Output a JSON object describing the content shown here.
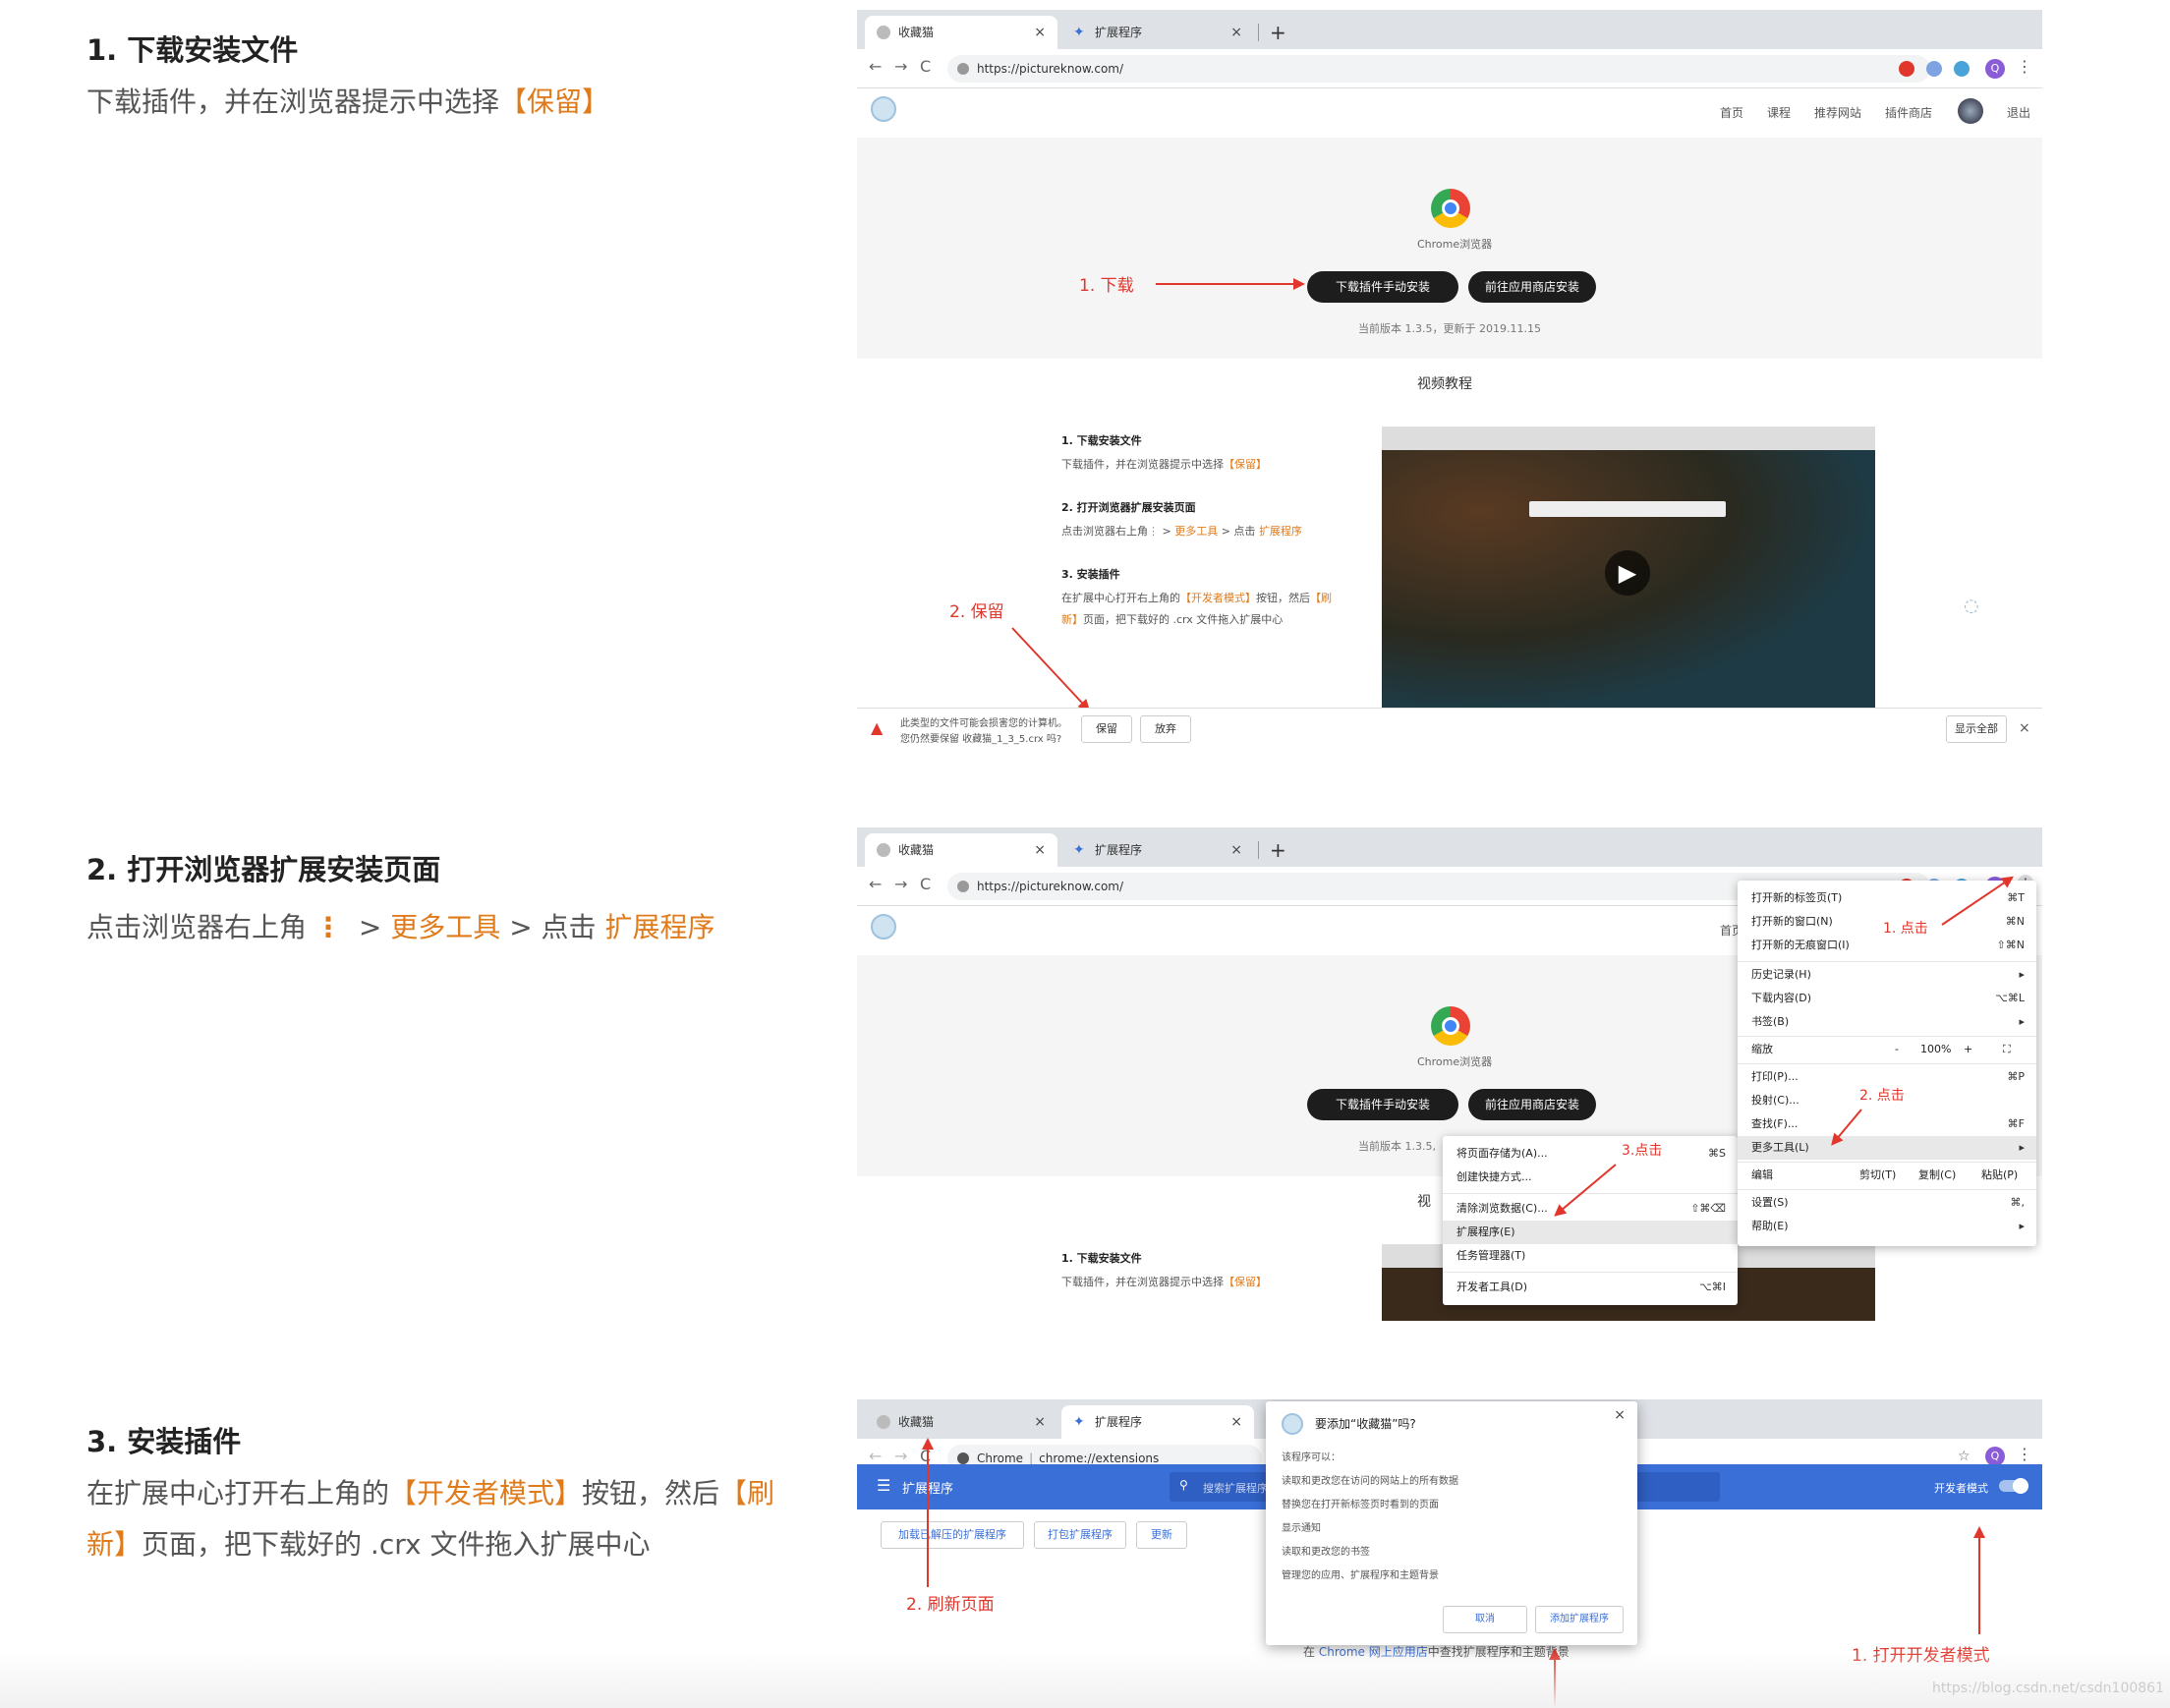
{
  "steps": [
    {
      "title": "1. 下载安装文件",
      "desc_pre": "下载插件，并在浏览器提示中选择",
      "desc_hl": "【保留】"
    },
    {
      "title": "2. 打开浏览器扩展安装页面",
      "desc_pre": "点击浏览器右上角",
      "dots": "⋮",
      "gt1": " > ",
      "hl1": "更多工具",
      "gt2": " > 点击 ",
      "hl2": "扩展程序"
    },
    {
      "title": "3. 安装插件",
      "l1_pre": "在扩展中心打开右上角的",
      "l1_hl": "【开发者模式】",
      "l1_mid": "按钮，然后",
      "l1_hl2": "【刷",
      "l2_hl": "新】",
      "l2_post": "页面，把下载好的 .crx 文件拖入扩展中心"
    }
  ],
  "browser": {
    "tab1": "收藏猫",
    "tab2": "扩展程序",
    "close": "×",
    "plus": "+",
    "back": "←",
    "forward": "→",
    "reload": "C",
    "url": "https://pictureknow.com/",
    "url_ext_chip": "Chrome",
    "url_ext": "chrome://extensions",
    "more": "⋮",
    "avatar": "Q",
    "star": "☆"
  },
  "site": {
    "nav": [
      "首页",
      "课程",
      "推荐网站",
      "插件商店",
      "退出"
    ],
    "chrome_caption": "Chrome浏览器",
    "btn_manual": "下载插件手动安装",
    "btn_store": "前往应用商店安装",
    "version": "当前版本 1.3.5，更新于 2019.11.15",
    "version_short": "当前版本 1.3.5,",
    "video_title": "视频教程",
    "video_title_short": "视",
    "mini": {
      "s1t": "1. 下载安装文件",
      "s1d_pre": "下载插件，并在浏览器提示中选择",
      "s1d_hl": "【保留】",
      "s2t": "2. 打开浏览器扩展安装页面",
      "s2d_pre": "点击浏览器右上角",
      "s2d_dots": "⋮",
      "s2d_gt1": " > ",
      "s2d_hl1": "更多工具",
      "s2d_gt2": " > 点击 ",
      "s2d_hl2": "扩展程序",
      "s3t": "3. 安装插件",
      "s3d1_pre": "在扩展中心打开右上角的",
      "s3d1_hl": "【开发者模式】",
      "s3d1_mid": "按钮，然后",
      "s3d1_hl2": "【刷",
      "s3d2_hl": "新】",
      "s3d2_post": "页面，把下载好的 .crx 文件拖入扩展中心"
    }
  },
  "download_bar": {
    "warn1": "此类型的文件可能会损害您的计算机。",
    "warn2": "您仍然要保留 收藏猫_1_3_5.crx 吗?",
    "keep": "保留",
    "discard": "放弃",
    "show_all": "显示全部",
    "close": "×"
  },
  "annotations": {
    "a1": "1. 下载",
    "a2": "2. 保留",
    "b1": "1. 点击",
    "b2": "2. 点击",
    "b3": "3.点击",
    "c1": "1. 打开开发者模式",
    "c2": "2. 刷新页面"
  },
  "chrome_menu": {
    "items": [
      {
        "label": "打开新的标签页(T)",
        "key": "⌘T"
      },
      {
        "label": "打开新的窗口(N)",
        "key": "⌘N"
      },
      {
        "label": "打开新的无痕窗口(I)",
        "key": "⇧⌘N"
      },
      {
        "label": "历史记录(H)",
        "key": "▸"
      },
      {
        "label": "下载内容(D)",
        "key": "⌥⌘L"
      },
      {
        "label": "书签(B)",
        "key": "▸"
      },
      {
        "label": "缩放",
        "key": ""
      },
      {
        "label": "打印(P)...",
        "key": "⌘P"
      },
      {
        "label": "投射(C)...",
        "key": ""
      },
      {
        "label": "查找(F)...",
        "key": "⌘F"
      },
      {
        "label": "更多工具(L)",
        "key": "▸"
      },
      {
        "label": "编辑",
        "key": ""
      },
      {
        "label": "设置(S)",
        "key": "⌘,"
      },
      {
        "label": "帮助(E)",
        "key": "▸"
      }
    ],
    "zoom": {
      "minus": "-",
      "value": "100%",
      "plus": "+",
      "full": "⛶"
    },
    "edit": {
      "cut": "剪切(T)",
      "copy": "复制(C)",
      "paste": "粘贴(P)"
    }
  },
  "submenu": {
    "items": [
      {
        "label": "将页面存储为(A)...",
        "key": "⌘S"
      },
      {
        "label": "创建快捷方式...",
        "key": ""
      },
      {
        "label": "清除浏览数据(C)...",
        "key": "⇧⌘⌫"
      },
      {
        "label": "扩展程序(E)",
        "key": ""
      },
      {
        "label": "任务管理器(T)",
        "key": ""
      },
      {
        "label": "开发者工具(D)",
        "key": "⌥⌘I"
      }
    ]
  },
  "ext_page": {
    "menu": "☰",
    "title": "扩展程序",
    "search": "搜索扩展程序",
    "dev_mode": "开发者模式",
    "btn_load": "加载已解压的扩展程序",
    "btn_pack": "打包扩展程序",
    "btn_update": "更新",
    "footer_pre": "在 ",
    "footer_link": "Chrome 网上应用店",
    "footer_post": "中查找扩展程序和主题背景"
  },
  "dialog": {
    "title": "要添加“收藏猫”吗?",
    "close": "×",
    "perm_head": "该程序可以：",
    "perms": [
      "读取和更改您在访问的网站上的所有数据",
      "替换您在打开新标签页时看到的页面",
      "显示通知",
      "读取和更改您的书签",
      "管理您的应用、扩展程序和主题背景"
    ],
    "cancel": "取消",
    "add": "添加扩展程序"
  },
  "watermark": "https://blog.csdn.net/csdn100861",
  "colors": {
    "accent": "#e07b1c",
    "annotation": "#e0362c",
    "chrome_blue": "#3b6fd8"
  }
}
